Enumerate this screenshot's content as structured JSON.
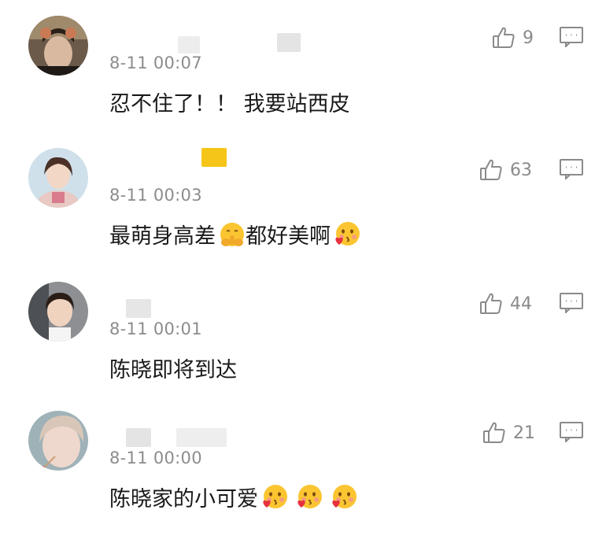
{
  "comments": [
    {
      "time": "8-11 00:07",
      "text": "忍不住了！！ 我要站西皮",
      "likes": "9",
      "emojis": [],
      "avatar_icon": "man-with-bear-ears-avatar"
    },
    {
      "time": "8-11 00:03",
      "text": "最萌身高差",
      "text_after": "都好美啊",
      "likes": "63",
      "emojis": [
        "shushing-face-emoji",
        "heart-kiss-face-emoji"
      ],
      "avatar_icon": "girl-portrait-avatar"
    },
    {
      "time": "8-11 00:01",
      "text": "陈晓即将到达",
      "likes": "44",
      "emojis": [],
      "avatar_icon": "child-portrait-avatar"
    },
    {
      "time": "8-11 00:00",
      "text": "陈晓家的小可爱",
      "likes": "21",
      "emojis": [
        "heart-kiss-face-emoji",
        "heart-kiss-face-emoji",
        "heart-kiss-face-emoji"
      ],
      "avatar_icon": "man-closeup-avatar"
    }
  ],
  "colors": {
    "time": "#8c8c8c",
    "text": "#1a1a1a",
    "like": "#8a8a8a",
    "name_blur": "#e6e6e6",
    "highlight": "#f5c518"
  }
}
